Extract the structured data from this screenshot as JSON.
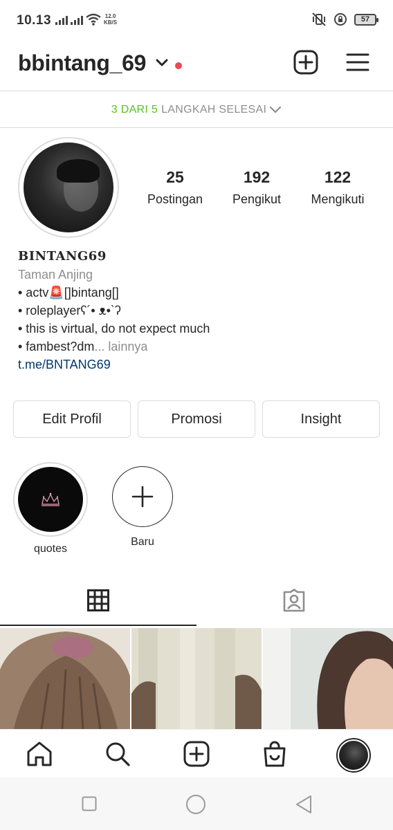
{
  "status_bar": {
    "time": "10.13",
    "net_speed_value": "12.0",
    "net_speed_unit": "KB/S",
    "battery": "57"
  },
  "header": {
    "username": "bbintang_69"
  },
  "setup": {
    "progress_done": "3 DARI 5",
    "progress_rest": "LANGKAH SELESAI"
  },
  "stats": [
    {
      "value": "25",
      "label": "Postingan"
    },
    {
      "value": "192",
      "label": "Pengikut"
    },
    {
      "value": "122",
      "label": "Mengikuti"
    }
  ],
  "bio": {
    "name": "BINTANG69",
    "category": "Taman Anjing",
    "lines": [
      "• actv🚨[]bintang[]",
      "• roleplayerʕ´• ᴥ•`ʔ",
      "• this is virtual, do not expect much"
    ],
    "last_line": "• fambest?dm",
    "more": "... lainnya",
    "link": "t.me/BNTANG69"
  },
  "actions": {
    "edit": "Edit Profil",
    "promote": "Promosi",
    "insight": "Insight"
  },
  "highlights": [
    {
      "label": "quotes"
    },
    {
      "label": "Baru"
    }
  ],
  "colors": {
    "accent_green": "#58c322",
    "notification_red": "#ed4956",
    "link_blue": "#00376b",
    "muted_gray": "#8e8e8e"
  },
  "icons": {
    "header": [
      "chevron-down-icon",
      "new-post-icon",
      "menu-icon"
    ],
    "tabs": [
      "grid-icon",
      "tagged-icon"
    ],
    "bottom_nav": [
      "home-icon",
      "search-icon",
      "create-icon",
      "shop-icon",
      "profile-icon"
    ],
    "system_nav": [
      "recents-icon",
      "home-circle-icon",
      "back-icon"
    ]
  }
}
